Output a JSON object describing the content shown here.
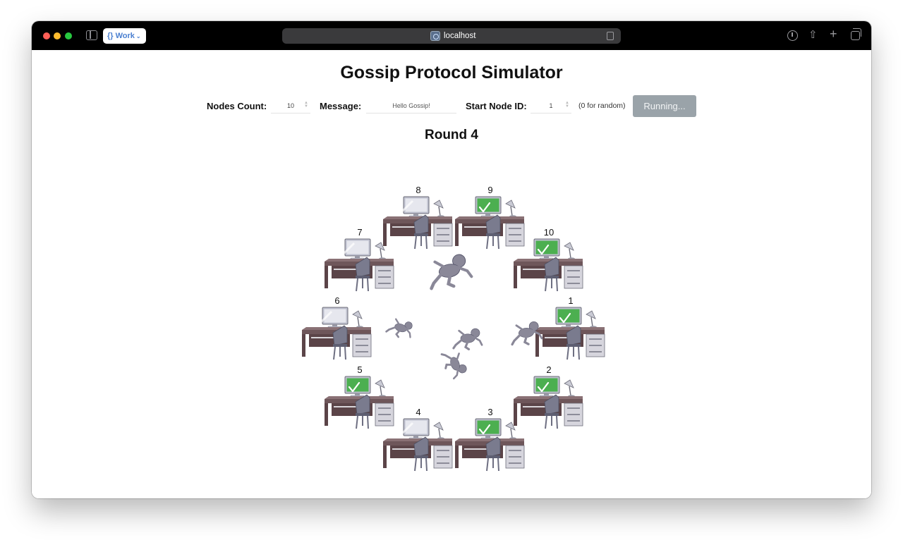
{
  "browser": {
    "workspace_label": "{} Work",
    "url": "localhost"
  },
  "page": {
    "title": "Gossip Protocol Simulator"
  },
  "controls": {
    "nodes_count_label": "Nodes Count:",
    "nodes_count_value": "10",
    "message_label": "Message:",
    "message_value": "Hello Gossip!",
    "start_node_label": "Start Node ID:",
    "start_node_value": "1",
    "start_node_hint": "(0 for random)",
    "run_button_label": "Running..."
  },
  "round": {
    "label": "Round 4"
  },
  "nodes": [
    {
      "id": "1",
      "informed": true
    },
    {
      "id": "2",
      "informed": true
    },
    {
      "id": "3",
      "informed": true
    },
    {
      "id": "4",
      "informed": false
    },
    {
      "id": "5",
      "informed": true
    },
    {
      "id": "6",
      "informed": false
    },
    {
      "id": "7",
      "informed": false
    },
    {
      "id": "8",
      "informed": false
    },
    {
      "id": "9",
      "informed": true
    },
    {
      "id": "10",
      "informed": true
    }
  ],
  "colors": {
    "informed_screen": "#4caf50",
    "uninformed_screen": "#e6e7ee",
    "desk": "#5b4448",
    "courier": "#8a8898",
    "button": "#9aa3a9"
  }
}
